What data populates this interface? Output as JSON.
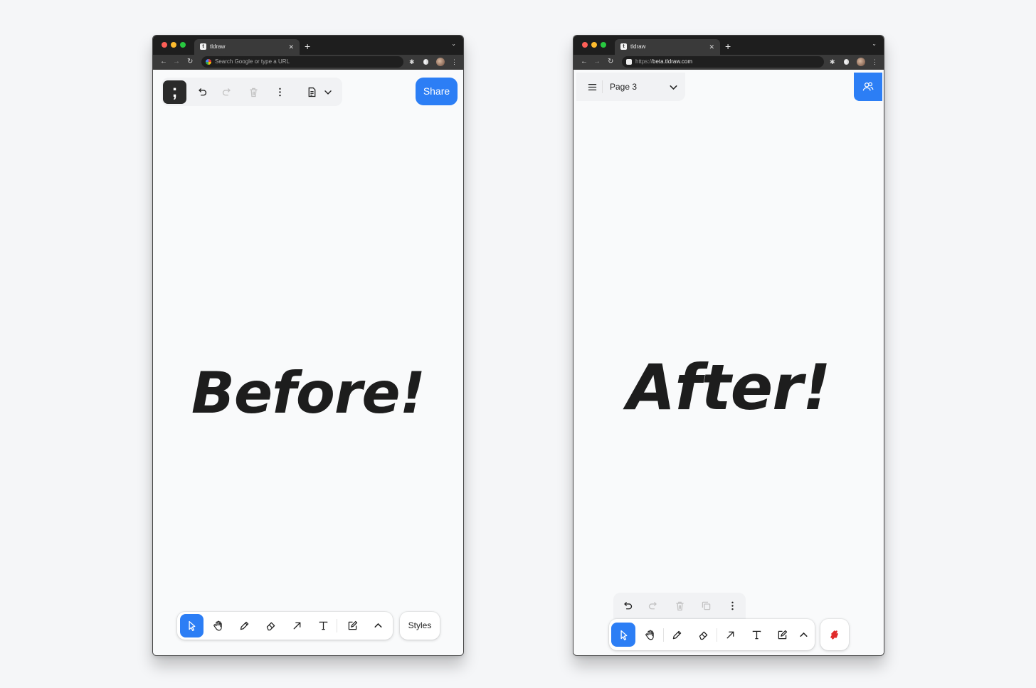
{
  "windows": {
    "before": {
      "tab_title": "tldraw",
      "favicon_glyph": "t",
      "omnibox_placeholder": "Search Google or type a URL",
      "share_label": "Share",
      "logo_glyph": ";",
      "canvas_text": "Before!",
      "styles_label": "Styles",
      "toolbar_icons": [
        "select-icon",
        "hand-icon",
        "pencil-icon",
        "eraser-icon",
        "arrow-icon",
        "text-icon",
        "note-icon",
        "chevron-up-icon"
      ],
      "active_tool": "select-icon"
    },
    "after": {
      "tab_title": "tldraw",
      "favicon_glyph": "t",
      "url_scheme": "https://",
      "url_host": "beta.tldraw.com",
      "page_label": "Page 3",
      "canvas_text": "After!",
      "toolbar_icons": [
        "select-icon",
        "hand-icon",
        "pencil-icon",
        "eraser-icon",
        "arrow-icon",
        "text-icon",
        "note-icon",
        "chevron-up-icon"
      ],
      "active_tool": "select-icon",
      "quick_actions": [
        "undo-icon",
        "redo-icon",
        "trash-icon",
        "duplicate-icon",
        "more-icon"
      ]
    }
  },
  "colors": {
    "accent": "#2c7ef5",
    "chrome_dark": "#1e1e1e",
    "canvas_bg": "#f9fafb",
    "scribble_red": "#e02b2b"
  }
}
